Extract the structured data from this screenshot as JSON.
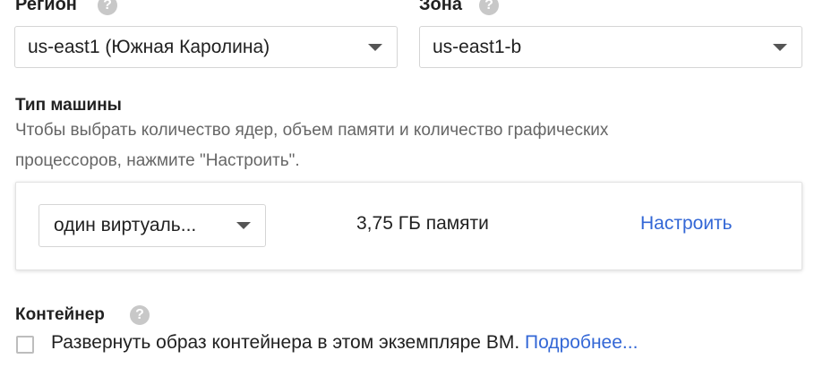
{
  "region": {
    "label": "Регион",
    "help_icon": "?",
    "selected": "us-east1 (Южная Каролина)"
  },
  "zone": {
    "label": "Зона",
    "help_icon": "?",
    "selected": "us-east1-b"
  },
  "machine_type": {
    "label": "Тип машины",
    "description_line1": "Чтобы выбрать количество ядер, объем памяти и количество графических",
    "description_line2": "процессоров, нажмите \"Настроить\".",
    "cores_selected": "один виртуаль...",
    "memory_text": "3,75 ГБ памяти",
    "customize_link": "Настроить"
  },
  "container": {
    "label": "Контейнер",
    "help_icon": "?",
    "checkbox_label": "Развернуть образ контейнера в этом экземпляре ВМ.",
    "learn_more_link": "Подробнее..."
  },
  "colors": {
    "link": "#3367d6",
    "text_primary": "#212121",
    "text_secondary": "#666666"
  }
}
